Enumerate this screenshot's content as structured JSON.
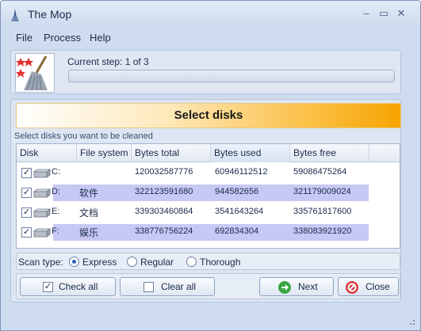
{
  "window": {
    "title": "The Mop"
  },
  "title_buttons": {
    "minimize": "–",
    "maximize": "▭",
    "close": "✕"
  },
  "menu": [
    "File",
    "Process",
    "Help"
  ],
  "step": {
    "text": "Current step: 1 of 3",
    "progress": 0
  },
  "banner": {
    "title": "Select disks"
  },
  "instruction": "Select disks you want to be cleaned",
  "columns": [
    "Disk",
    "File system",
    "Bytes total",
    "Bytes used",
    "Bytes free"
  ],
  "drives": [
    {
      "disk": "C:",
      "file_system": "",
      "bytes_total": "120032587776",
      "bytes_used": "60946112512",
      "bytes_free": "59086475264",
      "checked": true,
      "highlighted": false
    },
    {
      "disk": "D:",
      "file_system": "软件",
      "bytes_total": "322123591680",
      "bytes_used": "944582656",
      "bytes_free": "321179009024",
      "checked": true,
      "highlighted": true
    },
    {
      "disk": "E:",
      "file_system": "文档",
      "bytes_total": "339303460864",
      "bytes_used": "3541643264",
      "bytes_free": "335761817600",
      "checked": true,
      "highlighted": false
    },
    {
      "disk": "F:",
      "file_system": "娱乐",
      "bytes_total": "338776756224",
      "bytes_used": "692834304",
      "bytes_free": "338083921920",
      "checked": true,
      "highlighted": true
    }
  ],
  "scan": {
    "label": "Scan type:",
    "options": [
      "Express",
      "Regular",
      "Thorough"
    ],
    "selected": "Express"
  },
  "buttons": {
    "check_all": "Check all",
    "clear_all": "Clear all",
    "next": "Next",
    "close": "Close"
  },
  "check_mark": "✓",
  "colors": {
    "banner_accent": "#f6a400",
    "row_highlight": "#c7c8f4",
    "window_bg": "#cfdcef"
  }
}
